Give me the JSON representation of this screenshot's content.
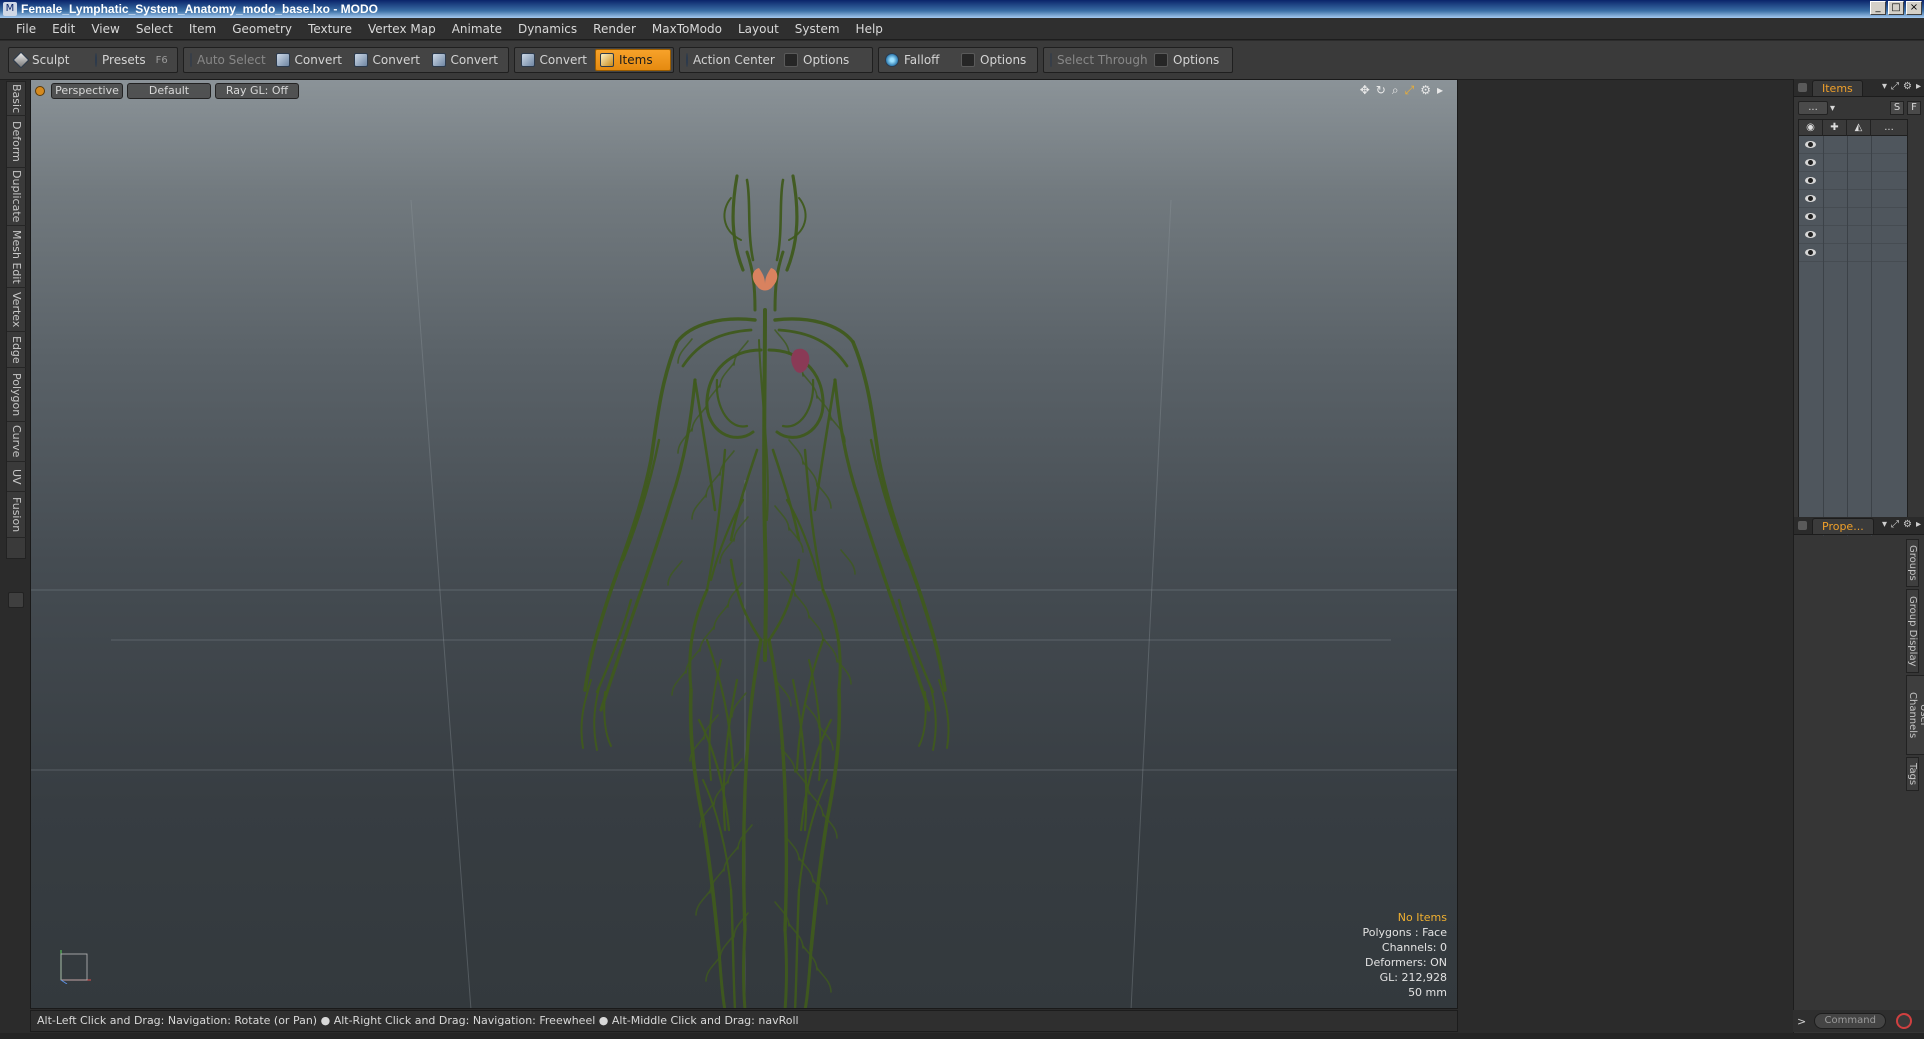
{
  "window": {
    "title": "Female_Lymphatic_System_Anatomy_modo_base.lxo - MODO",
    "controls": [
      "_",
      "□",
      "×"
    ]
  },
  "menu": [
    "File",
    "Edit",
    "View",
    "Select",
    "Item",
    "Geometry",
    "Texture",
    "Vertex Map",
    "Animate",
    "Dynamics",
    "Render",
    "MaxToModo",
    "Layout",
    "System",
    "Help"
  ],
  "toolbar": {
    "sculpt": "Sculpt",
    "presets": "Presets",
    "presets_key": "F6",
    "auto_select": "Auto Select",
    "convert1": "Convert",
    "convert2": "Convert",
    "convert3": "Convert",
    "convert4": "Convert",
    "items": "Items",
    "action_center": "Action Center",
    "options1": "Options",
    "falloff": "Falloff",
    "options2": "Options",
    "select_through": "Select Through",
    "options3": "Options"
  },
  "left_tabs": [
    "Basic",
    "Deform",
    "Duplicate",
    "Mesh Edit",
    "Vertex",
    "Edge",
    "Polygon",
    "Curve",
    "UV",
    "Fusion"
  ],
  "viewport": {
    "view": "Perspective",
    "shading": "Default",
    "raygl": "Ray GL: Off",
    "tool_icons": [
      "move-view-icon",
      "rotate-view-icon",
      "zoom-view-icon",
      "fit-view-icon",
      "gear-icon",
      "more-icon"
    ],
    "info": {
      "selection": "No Items",
      "polygons": "Polygons : Face",
      "channels": "Channels: 0",
      "deformers": "Deformers: ON",
      "gl": "GL: 212,928",
      "scale": "50 mm"
    },
    "colors": {
      "lymph": "#3f5a1e",
      "thyroid": "#d9825f",
      "spleen": "#8a3a56"
    }
  },
  "status": "Alt-Left Click and Drag: Navigation: Rotate (or Pan) ● Alt-Right Click and Drag: Navigation: Freewheel ● Alt-Middle Click and Drag: navRoll",
  "items_panel": {
    "tab": "Items",
    "dropdown": "...",
    "buttons": [
      "S",
      "F"
    ],
    "header_icons": [
      "eye-icon",
      "lock-icon",
      "mesh-icon",
      "..."
    ],
    "row_count": 7
  },
  "properties_panel": {
    "tab": "Prope...",
    "vtabs": [
      "Groups",
      "Group Display",
      "User Channels",
      "Tags"
    ]
  },
  "command": {
    "placeholder": "Command",
    "arrow": ">"
  }
}
